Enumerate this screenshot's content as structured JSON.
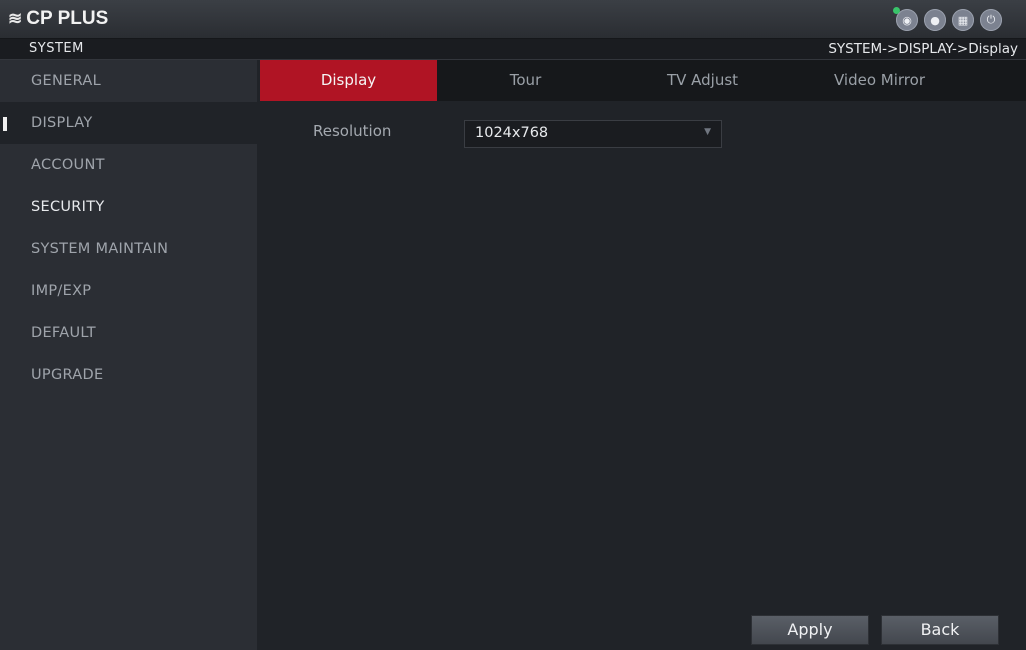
{
  "app": {
    "logo_text": "CP PLUS",
    "logo_mark": "≋"
  },
  "top_icons": [
    {
      "name": "live-view-icon",
      "glyph": "◉"
    },
    {
      "name": "user-icon",
      "glyph": "●"
    },
    {
      "name": "menu-grid-icon",
      "glyph": "▦"
    },
    {
      "name": "power-icon",
      "glyph": "⏻"
    }
  ],
  "header": {
    "section": "SYSTEM",
    "breadcrumb": "SYSTEM->DISPLAY->Display"
  },
  "sidebar": {
    "items": [
      {
        "label": "GENERAL"
      },
      {
        "label": "DISPLAY"
      },
      {
        "label": "ACCOUNT"
      },
      {
        "label": "SECURITY"
      },
      {
        "label": "SYSTEM MAINTAIN"
      },
      {
        "label": "IMP/EXP"
      },
      {
        "label": "DEFAULT"
      },
      {
        "label": "UPGRADE"
      }
    ]
  },
  "tabs": [
    {
      "label": "Display"
    },
    {
      "label": "Tour"
    },
    {
      "label": "TV Adjust"
    },
    {
      "label": "Video Mirror"
    }
  ],
  "form": {
    "resolution_label": "Resolution",
    "resolution_value": "1024x768"
  },
  "buttons": {
    "apply": "Apply",
    "back": "Back"
  },
  "colors": {
    "accent": "#b01424",
    "status_dot": "#39c46a"
  }
}
